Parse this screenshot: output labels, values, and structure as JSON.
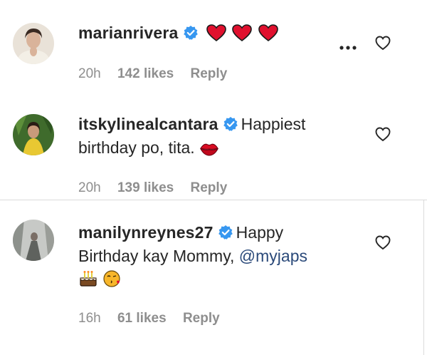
{
  "comments": [
    {
      "username": "marianrivera",
      "text": "",
      "emojis": [
        "red-heart",
        "red-heart",
        "red-heart"
      ],
      "time": "20h",
      "likes": "142 likes",
      "reply": "Reply"
    },
    {
      "username": "itskylinealcantara",
      "text_line1": "Happiest",
      "text_line2": "birthday po, tita.",
      "emojis": [
        "kiss-mark"
      ],
      "time": "20h",
      "likes": "139 likes",
      "reply": "Reply"
    },
    {
      "username": "manilynreynes27",
      "text_line1": "Happy",
      "text_line2": "Birthday kay Mommy,",
      "mention": "@myjaps",
      "emojis": [
        "birthday-cake",
        "face-blowing-kiss"
      ],
      "time": "16h",
      "likes": "61 likes",
      "reply": "Reply"
    }
  ],
  "colors": {
    "verified": "#3797f0",
    "muted": "#8e8e8e",
    "mention": "#2b4a7a",
    "heart_emoji": "#e0102e"
  },
  "icons": [
    "verified-badge-icon",
    "heart-outline-icon",
    "more-options-icon"
  ]
}
